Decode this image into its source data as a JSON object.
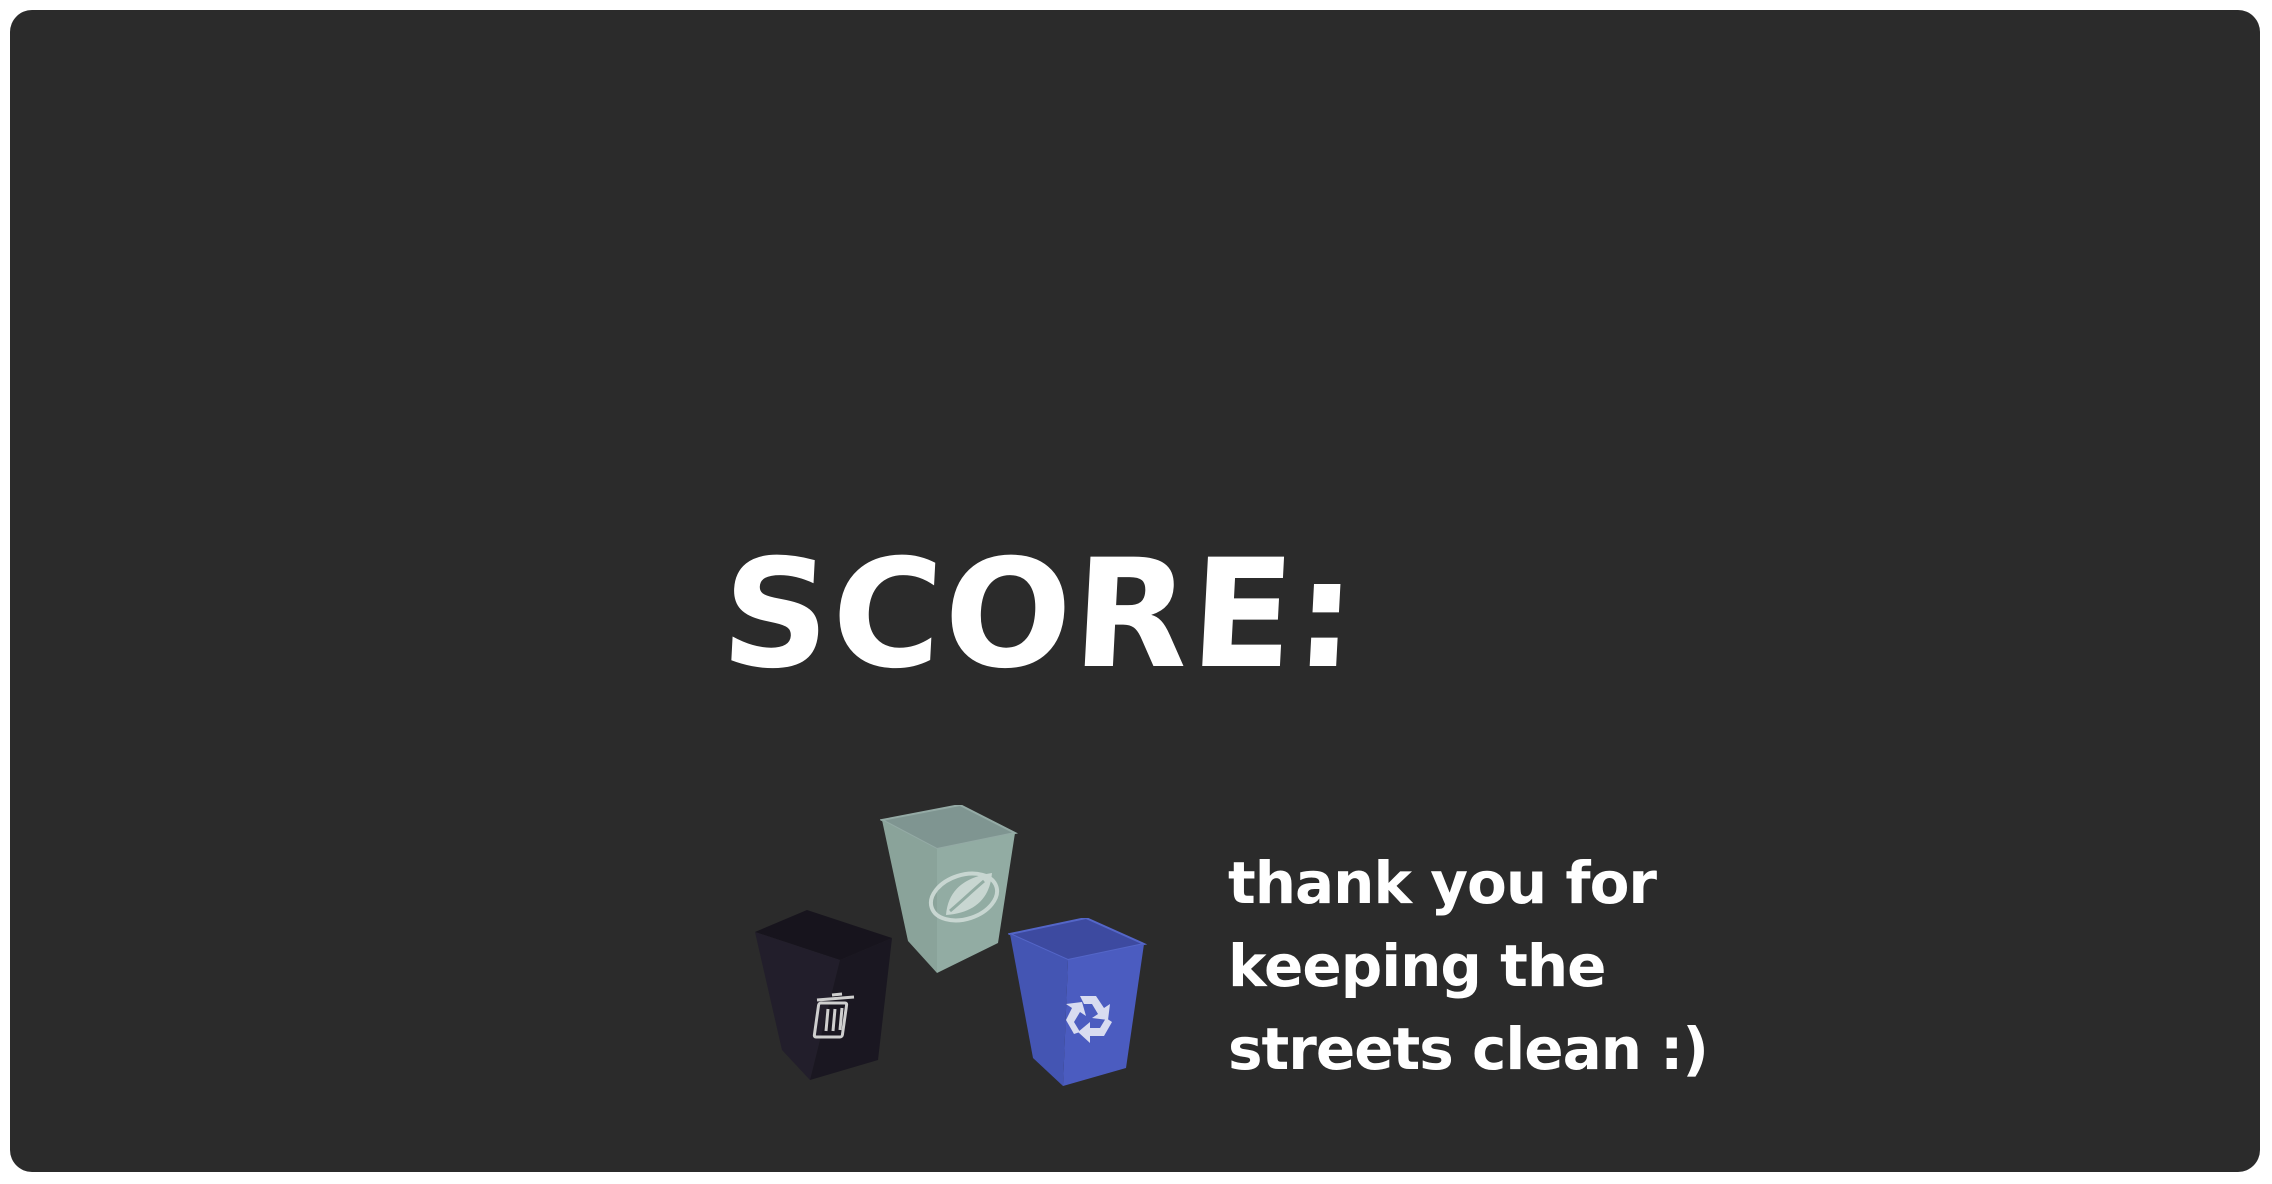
{
  "screen": {
    "background": "#2b2b2b"
  },
  "score": {
    "label": "SCORE:"
  },
  "message": {
    "lines": [
      "thank you for",
      "keeping the",
      "streets clean :)"
    ]
  },
  "bins": [
    {
      "kind": "trash",
      "icon": "trash-can-icon",
      "color": "#1e1b26"
    },
    {
      "kind": "compost",
      "icon": "leaf-icon",
      "color": "#8fa8a0"
    },
    {
      "kind": "recycling",
      "icon": "recycle-icon",
      "color": "#4759b8"
    }
  ]
}
